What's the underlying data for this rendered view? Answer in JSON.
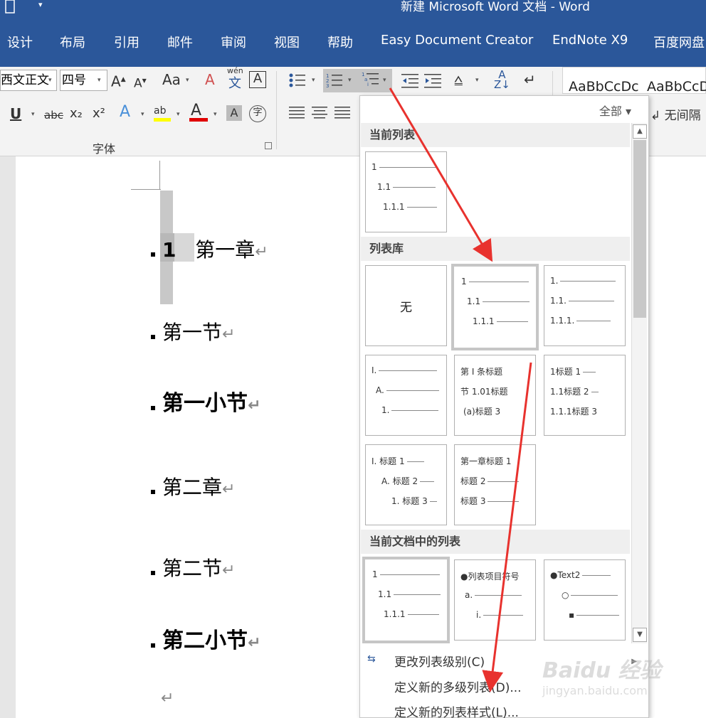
{
  "window": {
    "title": "新建 Microsoft Word 文档  -  Word"
  },
  "tabs": [
    "设计",
    "布局",
    "引用",
    "邮件",
    "审阅",
    "视图",
    "帮助",
    "Easy Document Creator",
    "EndNote X9",
    "百度网盘"
  ],
  "ribbon": {
    "font_name": "西文正文",
    "font_size": "四号",
    "font_group_label": "字体",
    "change_case": "Aa",
    "phonetic": "wén",
    "phonetic_char": "文",
    "underline": "U",
    "strike": "abc",
    "subscript": "x₂",
    "superscript": "x²",
    "enclose_char": "字",
    "style_samples": [
      "AaBbCcDc",
      "AaBbCcD"
    ],
    "style_no_spacing": "↲ 无间隔",
    "colors": {
      "highlight": "#ffff00",
      "font_color": "#e00000",
      "accent": "#2b579a"
    }
  },
  "document": {
    "lines": [
      {
        "number": "1",
        "text": "第一章",
        "style": "h1"
      },
      {
        "text": "第一节",
        "style": "h2"
      },
      {
        "text": "第一小节",
        "style": "h3"
      },
      {
        "text": "第二章",
        "style": "h1"
      },
      {
        "text": "第二节",
        "style": "h2"
      },
      {
        "text": "第二小节",
        "style": "h3"
      }
    ],
    "para_mark": "↵"
  },
  "gallery": {
    "filter_label": "全部",
    "sections": {
      "current": "当前列表",
      "library": "列表库",
      "in_document": "当前文档中的列表"
    },
    "none_label": "无",
    "thumbs": {
      "current": [
        "1",
        "1.1",
        "1.1.1"
      ],
      "lib_b": [
        "1",
        "1.1",
        "1.1.1"
      ],
      "lib_c": [
        "1.",
        "1.1.",
        "1.1.1."
      ],
      "lib_d": [
        "I.",
        "A.",
        "1."
      ],
      "lib_e": [
        "第 I 条标题",
        "节 1.01标题",
        "(a)标题 3"
      ],
      "lib_f": [
        "1标题 1",
        "1.1标题 2",
        "1.1.1标题 3"
      ],
      "lib_g": [
        "I. 标题 1",
        "A. 标题 2",
        "1. 标题 3"
      ],
      "lib_h": [
        "第一章标题 1",
        "标题 2",
        "标题 3"
      ],
      "doc_a": [
        "1",
        "1.1",
        "1.1.1"
      ],
      "doc_b": [
        "●列表项目符号",
        "a.",
        "i."
      ],
      "doc_c": [
        "●Text2",
        "○",
        "▪"
      ]
    },
    "menu": [
      "更改列表级别(C)",
      "定义新的多级列表(D)...",
      "定义新的列表样式(L)..."
    ]
  },
  "watermark": {
    "logo": "Baidu 经验",
    "url": "jingyan.baidu.com"
  }
}
